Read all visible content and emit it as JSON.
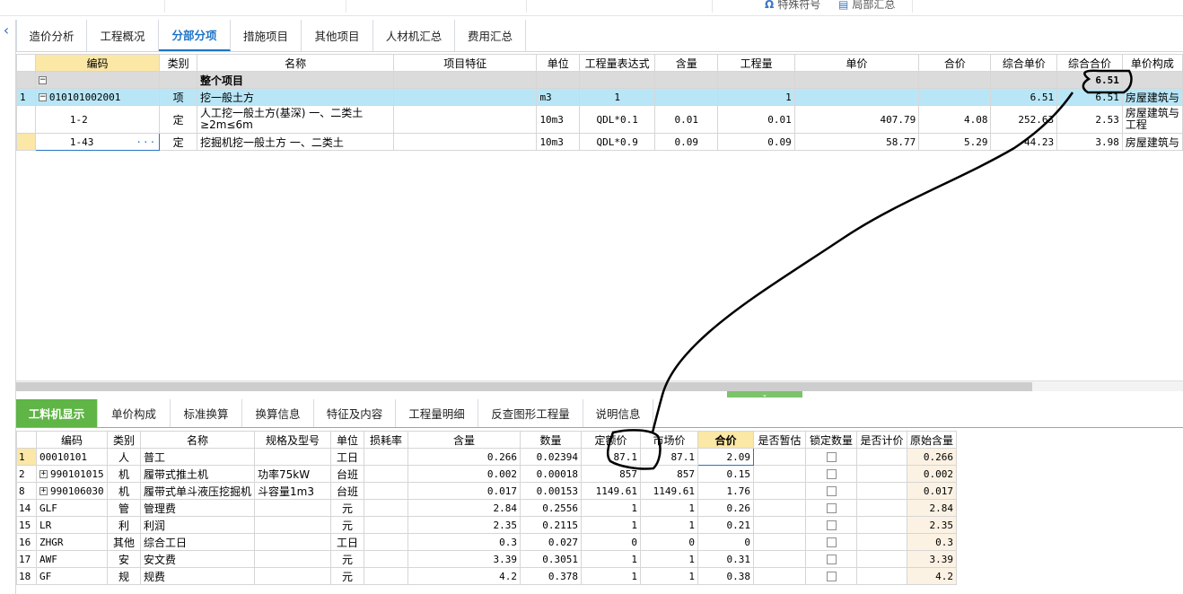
{
  "toolbar": {
    "special_symbol": "特殊符号",
    "partial_summary": "局部汇总"
  },
  "colors": {
    "accent": "#1d74c9",
    "green_tab": "#5fb545",
    "selected_row": "#b9e6f6",
    "header_yellow": "#fbe7a6"
  },
  "tabs_top": [
    "造价分析",
    "工程概况",
    "分部分项",
    "措施项目",
    "其他项目",
    "人材机汇总",
    "费用汇总"
  ],
  "top_table": {
    "headers": [
      "编码",
      "类别",
      "名称",
      "项目特征",
      "单位",
      "工程量表达式",
      "含量",
      "工程量",
      "单价",
      "合价",
      "综合单价",
      "综合合价",
      "单价构成"
    ],
    "group_row": {
      "name": "整个项目",
      "total": "6.51"
    },
    "rows": [
      {
        "num": "1",
        "code": "010101002001",
        "type": "项",
        "name": "挖一般土方",
        "feature": "",
        "unit": "m3",
        "expr": "1",
        "content": "",
        "qty": "1",
        "price": "",
        "total": "",
        "comp_price": "6.51",
        "comp_total": "6.51",
        "composition": "房屋建筑与"
      },
      {
        "num": "",
        "code": "1-2",
        "type": "定",
        "name": "人工挖一般土方(基深) 一、二类土 ≥2m≤6m",
        "feature": "",
        "unit": "10m3",
        "expr": "QDL*0.1",
        "content": "0.01",
        "qty": "0.01",
        "price": "407.79",
        "total": "4.08",
        "comp_price": "252.63",
        "comp_total": "2.53",
        "composition": "房屋建筑与工程"
      },
      {
        "num": "",
        "code": "1-43",
        "type": "定",
        "name": "挖掘机挖一般土方 一、二类土",
        "feature": "",
        "unit": "10m3",
        "expr": "QDL*0.9",
        "content": "0.09",
        "qty": "0.09",
        "price": "58.77",
        "total": "5.29",
        "comp_price": "44.23",
        "comp_total": "3.98",
        "composition": "房屋建筑与"
      }
    ]
  },
  "tabs_bottom": [
    "工料机显示",
    "单价构成",
    "标准换算",
    "换算信息",
    "特征及内容",
    "工程量明细",
    "反查图形工程量",
    "说明信息"
  ],
  "bottom_table": {
    "headers": [
      "编码",
      "类别",
      "名称",
      "规格及型号",
      "单位",
      "损耗率",
      "含量",
      "数量",
      "定额价",
      "市场价",
      "合价",
      "是否暂估",
      "锁定数量",
      "是否计价",
      "原始含量"
    ],
    "rows": [
      {
        "num": "1",
        "code": "00010101",
        "type": "人",
        "name": "普工",
        "spec": "",
        "unit": "工日",
        "loss": "",
        "content": "0.266",
        "qty": "0.02394",
        "quota": "87.1",
        "market": "87.1",
        "total": "2.09",
        "orig": "0.266",
        "expand": false
      },
      {
        "num": "2",
        "code": "990101015",
        "type": "机",
        "name": "履带式推土机",
        "spec": "功率75kW",
        "unit": "台班",
        "loss": "",
        "content": "0.002",
        "qty": "0.00018",
        "quota": "857",
        "market": "857",
        "total": "0.15",
        "orig": "0.002",
        "expand": true
      },
      {
        "num": "8",
        "code": "990106030",
        "type": "机",
        "name": "履带式单斗液压挖掘机",
        "spec": "斗容量1m3",
        "unit": "台班",
        "loss": "",
        "content": "0.017",
        "qty": "0.00153",
        "quota": "1149.61",
        "market": "1149.61",
        "total": "1.76",
        "orig": "0.017",
        "expand": true
      },
      {
        "num": "14",
        "code": "GLF",
        "type": "管",
        "name": "管理费",
        "spec": "",
        "unit": "元",
        "loss": "",
        "content": "2.84",
        "qty": "0.2556",
        "quota": "1",
        "market": "1",
        "total": "0.26",
        "orig": "2.84",
        "expand": false
      },
      {
        "num": "15",
        "code": "LR",
        "type": "利",
        "name": "利润",
        "spec": "",
        "unit": "元",
        "loss": "",
        "content": "2.35",
        "qty": "0.2115",
        "quota": "1",
        "market": "1",
        "total": "0.21",
        "orig": "2.35",
        "expand": false
      },
      {
        "num": "16",
        "code": "ZHGR",
        "type": "其他",
        "name": "综合工日",
        "spec": "",
        "unit": "工日",
        "loss": "",
        "content": "0.3",
        "qty": "0.027",
        "quota": "0",
        "market": "0",
        "total": "0",
        "orig": "0.3",
        "expand": false
      },
      {
        "num": "17",
        "code": "AWF",
        "type": "安",
        "name": "安文费",
        "spec": "",
        "unit": "元",
        "loss": "",
        "content": "3.39",
        "qty": "0.3051",
        "quota": "1",
        "market": "1",
        "total": "0.31",
        "orig": "3.39",
        "expand": false
      },
      {
        "num": "18",
        "code": "GF",
        "type": "规",
        "name": "规费",
        "spec": "",
        "unit": "元",
        "loss": "",
        "content": "4.2",
        "qty": "0.378",
        "quota": "1",
        "market": "1",
        "total": "0.38",
        "orig": "4.2",
        "expand": false
      }
    ]
  }
}
